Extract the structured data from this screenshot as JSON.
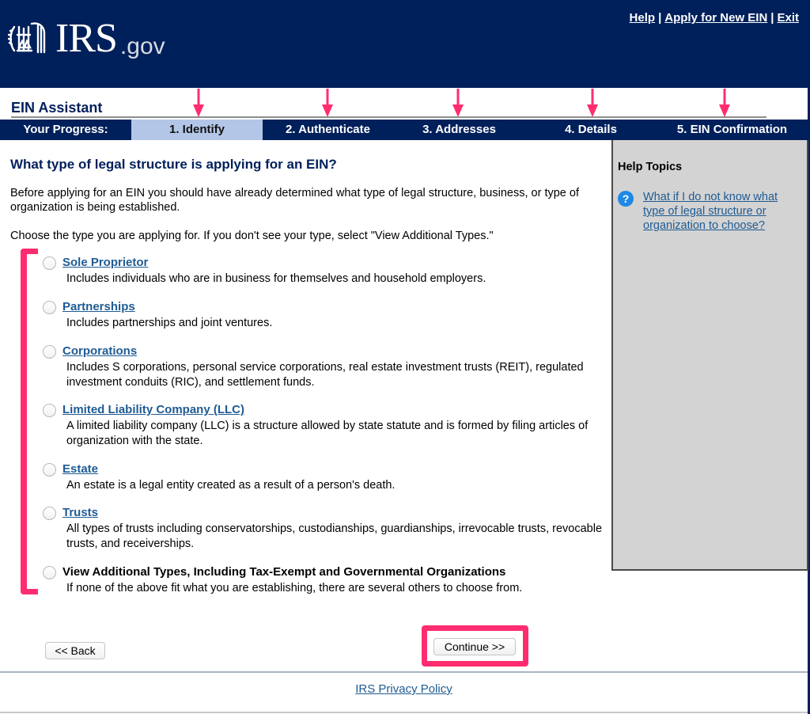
{
  "header": {
    "logo_text": "IRS",
    "logo_suffix": ".gov",
    "links": [
      {
        "label": "Help"
      },
      {
        "label": "Apply for New EIN"
      },
      {
        "label": "Exit"
      }
    ],
    "separator": "|"
  },
  "assistant": {
    "title": "EIN Assistant"
  },
  "progress": {
    "label": "Your Progress:",
    "steps": [
      {
        "label": "1. Identify",
        "active": true
      },
      {
        "label": "2. Authenticate",
        "active": false
      },
      {
        "label": "3. Addresses",
        "active": false
      },
      {
        "label": "4. Details",
        "active": false
      },
      {
        "label": "5. EIN Confirmation",
        "active": false
      }
    ]
  },
  "main": {
    "question": "What type of legal structure is applying for an EIN?",
    "intro": "Before applying for an EIN you should have already determined what type of legal structure, business, or type of organization is being established.",
    "instruction": "Choose the type you are applying for. If you don't see your type, select \"View Additional Types.\"",
    "options": [
      {
        "label": "Sole Proprietor",
        "desc": "Includes individuals who are in business for themselves and household employers.",
        "link": true
      },
      {
        "label": "Partnerships",
        "desc": "Includes partnerships and joint ventures.",
        "link": true
      },
      {
        "label": "Corporations",
        "desc": "Includes S corporations, personal service corporations, real estate investment trusts (REIT), regulated investment conduits (RIC), and settlement funds.",
        "link": true
      },
      {
        "label": "Limited Liability Company (LLC)",
        "desc": "A limited liability company (LLC) is a structure allowed by state statute and is formed by filing articles of organization with the state.",
        "link": true
      },
      {
        "label": "Estate",
        "desc": "An estate is a legal entity created as a result of a person's death.",
        "link": true
      },
      {
        "label": "Trusts",
        "desc": "All types of trusts including conservatorships, custodianships, guardianships, irrevocable trusts, revocable trusts, and receiverships.",
        "link": true
      },
      {
        "label": "View Additional Types, Including Tax-Exempt and Governmental Organizations",
        "desc": "If none of the above fit what you are establishing, there are several others to choose from.",
        "link": false
      }
    ]
  },
  "help": {
    "title": "Help Topics",
    "icon": "question-circle-icon",
    "icon_glyph": "?",
    "link": "What if I do not know what type of legal structure or organization to choose?"
  },
  "buttons": {
    "back": "<< Back",
    "continue": "Continue >>"
  },
  "footer": {
    "privacy": "IRS Privacy Policy"
  },
  "colors": {
    "navy": "#00205b",
    "active_step": "#b4c6e7",
    "link": "#1f5b93",
    "annotation": "#ff2d6f",
    "help_panel": "#d3d3d3"
  }
}
